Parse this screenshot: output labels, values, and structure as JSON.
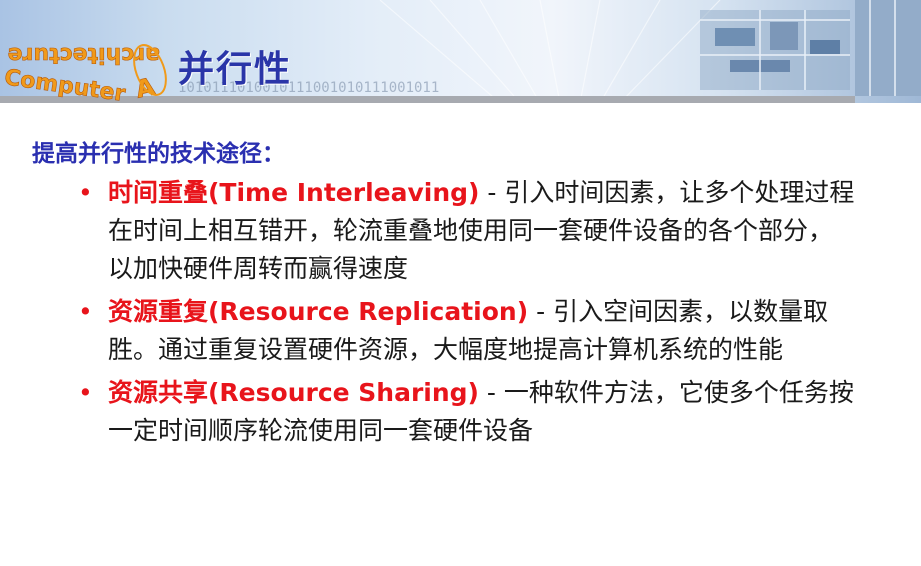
{
  "header": {
    "logo_text_top": "architecture",
    "logo_text_bottom": "Computer",
    "logo_letter": "A",
    "binary_strip": "1010111010010111001010111001011",
    "title": "并行性"
  },
  "body": {
    "subheading": "提高并行性的技术途径：",
    "bullets": [
      {
        "term": "时间重叠(Time Interleaving)",
        "desc": " - 引入时间因素，让多个处理过程在时间上相互错开，轮流重叠地使用同一套硬件设备的各个部分，以加快硬件周转而赢得速度"
      },
      {
        "term": "资源重复(Resource Replication)",
        "desc": " - 引入空间因素，以数量取胜。通过重复设置硬件资源，大幅度地提高计算机系统的性能"
      },
      {
        "term": "资源共享(Resource Sharing)",
        "desc": " - 一种软件方法，它使多个任务按一定时间顺序轮流使用同一套硬件设备"
      }
    ]
  },
  "colors": {
    "title": "#2a35a8",
    "term": "#e8141b",
    "bullet": "#e8141b",
    "text": "#1a1a1a"
  }
}
